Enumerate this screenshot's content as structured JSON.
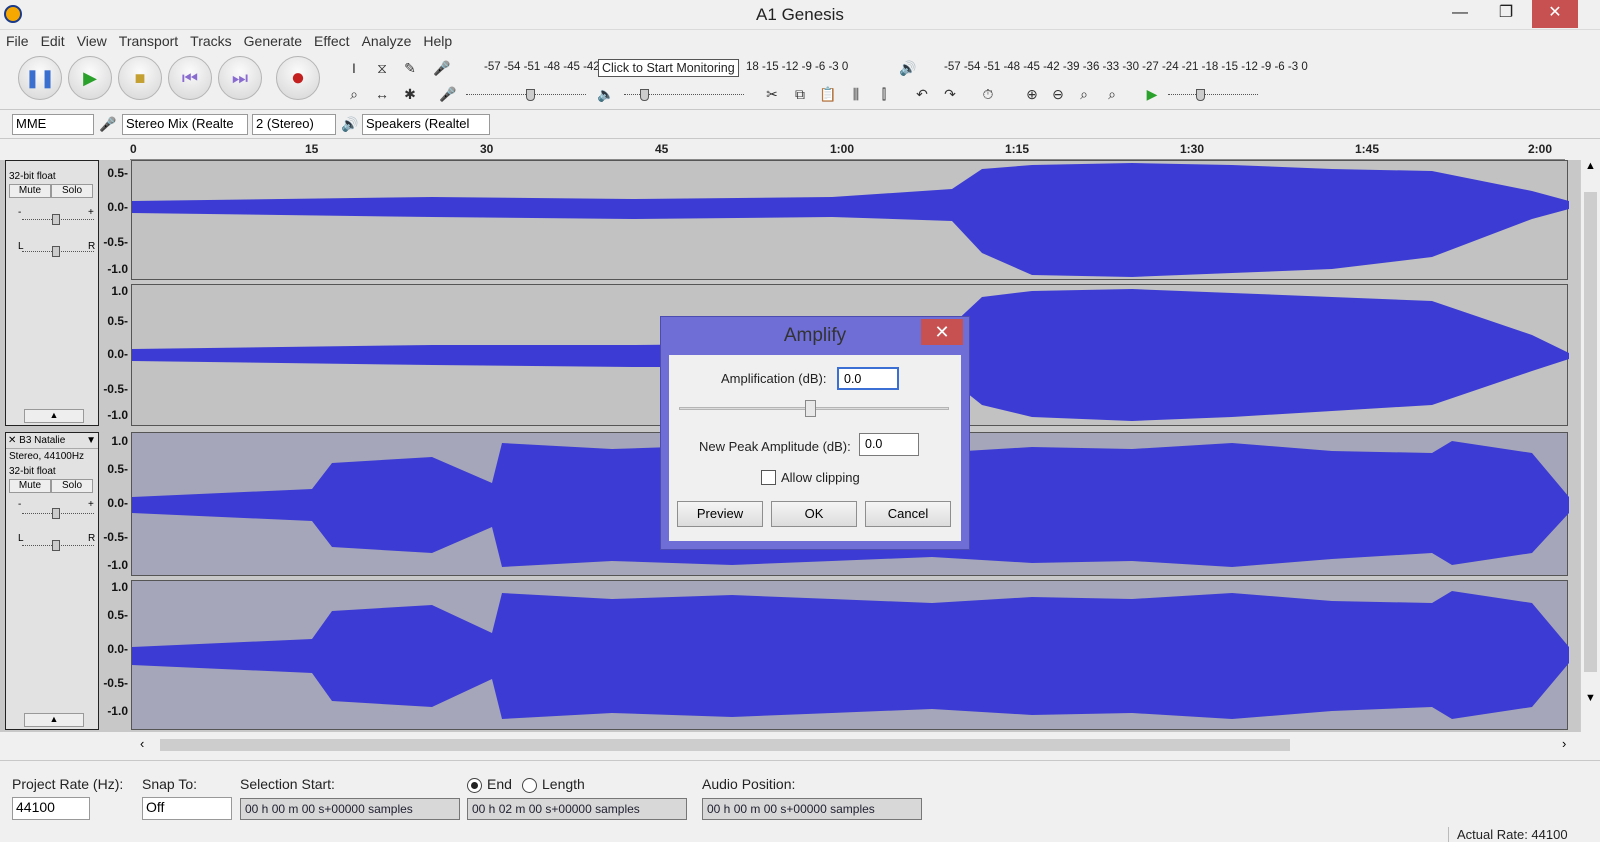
{
  "window": {
    "title": "A1 Genesis",
    "min_label": "—",
    "max_label": "❐",
    "close_label": "✕"
  },
  "menu": [
    "File",
    "Edit",
    "View",
    "Transport",
    "Tracks",
    "Generate",
    "Effect",
    "Analyze",
    "Help"
  ],
  "transport": {
    "pause": "❚❚",
    "play": "▶",
    "stop": "■",
    "skip_start": "⏮",
    "skip_end": "⏭",
    "record": "●"
  },
  "meters": {
    "record_scale": "-57 -54 -51 -48 -45 -42",
    "record_tip": "Click to Start Monitoring",
    "record_scale_tail": "18 -15 -12 -9 -6 -3 0",
    "play_scale": "-57 -54 -51 -48 -45 -42 -39 -36 -33 -30 -27 -24 -21 -18 -15 -12 -9 -6 -3 0",
    "lr": "L\nR"
  },
  "device": {
    "host": "MME",
    "input": "Stereo Mix (Realte",
    "channels": "2 (Stereo)",
    "output": "Speakers (Realtel"
  },
  "ruler": [
    "0",
    "15",
    "30",
    "45",
    "1:00",
    "1:15",
    "1:30",
    "1:45",
    "2:00"
  ],
  "track1": {
    "format": "32-bit float",
    "mute": "Mute",
    "solo": "Solo",
    "minus": "-",
    "plus": "+",
    "l": "L",
    "r": "R",
    "scale_top": [
      "0.5-",
      "0.0-",
      "-0.5-",
      "-1.0"
    ],
    "scale_bottom": [
      "1.0",
      "0.5-",
      "0.0-",
      "-0.5-",
      "-1.0"
    ]
  },
  "track2": {
    "name": "B3 Natalie",
    "info": "Stereo, 44100Hz",
    "format": "32-bit float",
    "mute": "Mute",
    "solo": "Solo",
    "minus": "-",
    "plus": "+",
    "l": "L",
    "r": "R",
    "scale": [
      "1.0",
      "0.5-",
      "0.0-",
      "-0.5-",
      "-1.0"
    ]
  },
  "dialog": {
    "title": "Amplify",
    "close": "✕",
    "amp_label": "Amplification (dB):",
    "amp_value": "0.0",
    "peak_label": "New Peak Amplitude (dB):",
    "peak_value": "0.0",
    "clip_label": "Allow clipping",
    "preview": "Preview",
    "ok": "OK",
    "cancel": "Cancel"
  },
  "status": {
    "rate_label": "Project Rate (Hz):",
    "rate_value": "44100",
    "snap_label": "Snap To:",
    "snap_value": "Off",
    "sel_start_label": "Selection Start:",
    "end_label": "End",
    "length_label": "Length",
    "audio_pos_label": "Audio Position:",
    "sel_start": "00 h 00 m 00 s+00000 samples",
    "sel_end": "00 h 02 m 00 s+00000 samples",
    "audio_pos": "00 h 00 m 00 s+00000 samples",
    "actual_rate": "Actual Rate: 44100"
  },
  "colors": {
    "wave": "#3c3cd4",
    "accent": "#6e6ed6"
  }
}
